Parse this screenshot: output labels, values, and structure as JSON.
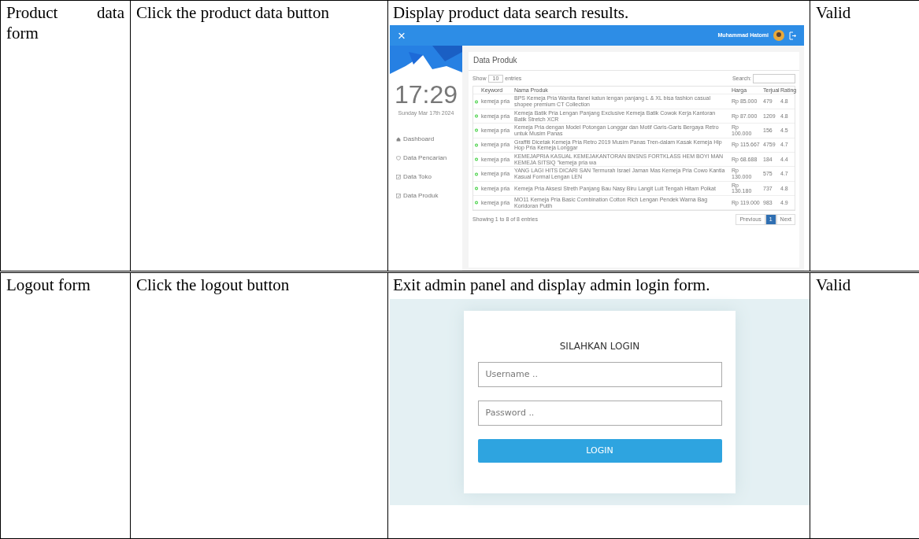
{
  "rows": [
    {
      "form": "Product data form",
      "action": "Click the product data button",
      "result": "Display product data search results.",
      "status": "Valid",
      "screen": {
        "kind": "admin",
        "close_icon": "×",
        "user": "Muhammad Hatomi",
        "clock": "17:29",
        "date": "Sunday Mar 17th 2024",
        "nav": [
          "Dashboard",
          "Data Pencarian",
          "Data Toko",
          "Data Produk"
        ],
        "title": "Data Produk",
        "show_label": "Show",
        "show_value": "10",
        "entries_label": "entries",
        "search_label": "Search:",
        "columns": [
          "Keyword",
          "Nama Produk",
          "Harga",
          "Terjual",
          "Rating"
        ],
        "products": [
          [
            "kemeja pria",
            "BPS Kemeja Pria Wanita flanel katun lengan panjang L & XL bisa fashion casual shopee premium CT Collection",
            "Rp 85.000",
            "479",
            "4.8"
          ],
          [
            "kemeja pria",
            "Kemeja Batik Pria Lengan Panjang Exclusive Kemeja Batik Cowok Kerja Kantoran Batik Stretch XCR",
            "Rp 87.000",
            "1209",
            "4.8"
          ],
          [
            "kemeja pria",
            "Kemeja Pria dengan Model Potongan Longgar dan Motif Garis-Garis Bergaya Retro untuk Musim Panas",
            "Rp 100.000",
            "156",
            "4.5"
          ],
          [
            "kemeja pria",
            "Graffiti Dicetak Kemeja Pria Retro 2019 Musim Panas Tren-dalam Kasak Kemeja Hip Hop Pria Kemeja Longgar",
            "Rp 115.667",
            "4759",
            "4.7"
          ],
          [
            "kemeja pria",
            "KEMEJAPRIA KASUAL KEMEJAKANTORAN BNSNS FORTKLASS HEM BOYI MAN KEMEJA SITSIQ \"kemeja pria wa",
            "Rp 68.688",
            "184",
            "4.4"
          ],
          [
            "kemeja pria",
            "YANG LAGI HITS DICARI SAN Termurah Israel Jaman Mas Kemeja Pria Cowo Kantia Kasual Formal Lengan LEN",
            "Rp 130.000",
            "575",
            "4.7"
          ],
          [
            "kemeja pria",
            "Kemeja Pria Aksesi Streth Panjang Bau Nasy Biru Langit Luit Tengah Hitam Polkat",
            "Rp 130.180",
            "737",
            "4.8"
          ],
          [
            "kemeja pria",
            "MO11 Kemeja Pria Basic Combination Cotton Rich Lengan Pendek Warna Bag Koridoran Putih",
            "Rp 119.000",
            "983",
            "4.9"
          ]
        ],
        "info": "Showing 1 to 8 of 8 entries",
        "pages": [
          {
            "label": "Previous",
            "selected": false
          },
          {
            "label": "1",
            "selected": true
          },
          {
            "label": "Next",
            "selected": false
          }
        ]
      }
    },
    {
      "form": "Logout form",
      "action": "Click the logout button",
      "result": "Exit admin panel and display admin login form.",
      "status": "Valid",
      "screen": {
        "kind": "login",
        "heading": "SILAHKAN LOGIN",
        "username_placeholder": "Username ..",
        "password_placeholder": "Password ..",
        "button": "LOGIN"
      }
    }
  ]
}
